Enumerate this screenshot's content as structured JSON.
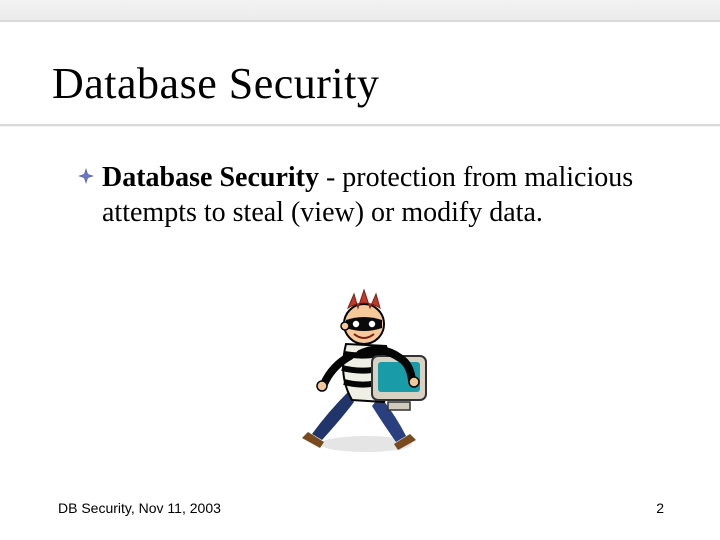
{
  "title": "Database Security",
  "bullet": {
    "term": "Database Security",
    "rest": " - protection from malicious attempts to steal (view) or modify data."
  },
  "clipart": {
    "alt": "thief-running-with-computer-monitor"
  },
  "footer": {
    "left": "DB Security, Nov 11, 2003",
    "page": "2"
  }
}
